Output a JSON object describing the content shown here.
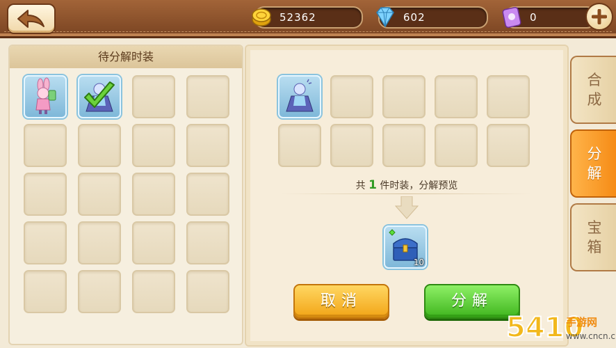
{
  "top_bar": {
    "back_icon": "back-arrow-icon",
    "resources": [
      {
        "name": "gold",
        "icon": "gold-coin-icon",
        "value": "52362"
      },
      {
        "name": "diamond",
        "icon": "diamond-icon",
        "value": "602"
      },
      {
        "name": "ticket",
        "icon": "ticket-icon",
        "value": "0"
      }
    ],
    "add_icon": "plus-icon"
  },
  "left_panel": {
    "title": "待分解时装",
    "slots": [
      {
        "item": "costume-pink-bunny",
        "selected": false
      },
      {
        "item": "costume-blue-dress",
        "selected": true
      }
    ],
    "total_slots": 20
  },
  "right_panel": {
    "preview_items": [
      "costume-blue-dress"
    ],
    "total_slots": 10,
    "summary_prefix": "共",
    "summary_count": "1",
    "summary_suffix": "件时装，分解预览",
    "result": {
      "icon": "treasure-chest-icon",
      "quantity": "10"
    },
    "cancel_label": "取消",
    "decompose_label": "分解"
  },
  "tabs": [
    {
      "label_1": "合",
      "label_2": "成",
      "active": false
    },
    {
      "label_1": "分",
      "label_2": "解",
      "active": true
    },
    {
      "label_1": "宝",
      "label_2": "箱",
      "active": false
    }
  ],
  "watermark": {
    "number": "5410",
    "name": "手游网",
    "url": "www.cncn.cn"
  },
  "colors": {
    "accent_orange": "#f58a14",
    "confirm_green": "#3fb51e",
    "cancel_yellow": "#f2a416",
    "frame_brown": "#7a4422"
  }
}
